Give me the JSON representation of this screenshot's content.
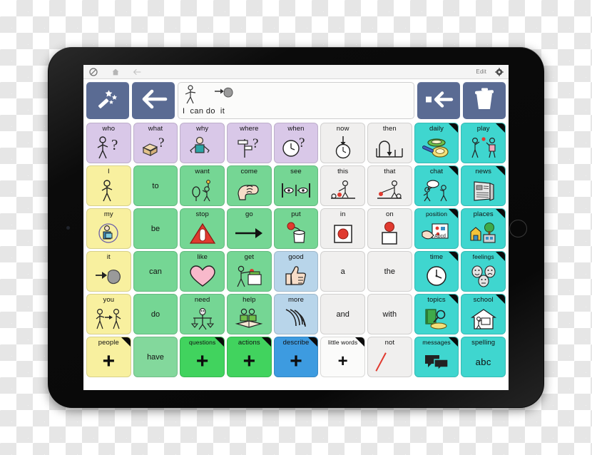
{
  "app": {
    "device": "tablet",
    "chrome": {
      "left_icons": [
        "no-entry-icon",
        "home-icon",
        "back-arrow-icon"
      ],
      "edit_label": "Edit",
      "right_icons": [
        "gear-icon"
      ]
    },
    "toolbar": {
      "predict_button": "magic-wand-icon",
      "back_button": "left-arrow-icon",
      "backspace_button": "backspace-icon",
      "clear_button": "trash-icon",
      "accent_color": "#5a6b93"
    },
    "message_bar": {
      "words": [
        "I",
        "can do",
        "it"
      ],
      "sentence": "I can do it",
      "symbols": [
        "stick-figure-icon",
        "arrow-to-blob-icon"
      ]
    }
  },
  "colors": {
    "lavender": "#d9c8e8",
    "white": "#f0efee",
    "teal": "#3fd6cf",
    "yellow": "#f8f09f",
    "green": "#75d694",
    "light_green": "#83d89c",
    "light_blue": "#b8d5ea",
    "bright_green": "#41d35e",
    "bright_blue": "#3d9be0",
    "toolbar_blue": "#5a6b93",
    "red_slash": "#e03a2f"
  },
  "grid": {
    "columns": 9,
    "rows": 6,
    "cells": [
      [
        {
          "label": "who",
          "color": "lavender",
          "icon": "person-question-icon",
          "fold": false
        },
        {
          "label": "what",
          "color": "lavender",
          "icon": "box-question-icon",
          "fold": false
        },
        {
          "label": "why",
          "color": "lavender",
          "icon": "shrug-person-icon",
          "fold": false
        },
        {
          "label": "where",
          "color": "lavender",
          "icon": "signpost-question-icon",
          "fold": false
        },
        {
          "label": "when",
          "color": "lavender",
          "icon": "clock-question-icon",
          "fold": false
        },
        {
          "label": "now",
          "color": "white",
          "icon": "clock-arrow-icon",
          "fold": false
        },
        {
          "label": "then",
          "color": "white",
          "icon": "sequence-arrow-icon",
          "fold": false
        },
        {
          "label": "daily",
          "color": "teal",
          "icon": "toothbrush-soap-icon",
          "fold": true
        },
        {
          "label": "play",
          "color": "teal",
          "icon": "two-people-ball-icon",
          "fold": true
        }
      ],
      [
        {
          "label": "I",
          "color": "yellow",
          "icon": "stick-figure-icon",
          "fold": false
        },
        {
          "label": "to",
          "color": "green",
          "icon": "",
          "fold": false,
          "center_text": true
        },
        {
          "label": "want",
          "color": "green",
          "icon": "person-reaching-icon",
          "fold": false
        },
        {
          "label": "come",
          "color": "green",
          "icon": "beckoning-hand-icon",
          "fold": false
        },
        {
          "label": "see",
          "color": "green",
          "icon": "eyes-between-bars-icon",
          "fold": false
        },
        {
          "label": "this",
          "color": "white",
          "icon": "person-pointing-near-icon",
          "fold": false
        },
        {
          "label": "that",
          "color": "white",
          "icon": "person-pointing-far-icon",
          "fold": false
        },
        {
          "label": "chat",
          "color": "teal",
          "icon": "two-people-talking-icon",
          "fold": true
        },
        {
          "label": "news",
          "color": "teal",
          "icon": "newspaper-icon",
          "fold": true
        }
      ],
      [
        {
          "label": "my",
          "color": "yellow",
          "icon": "person-holding-circle-icon",
          "fold": false
        },
        {
          "label": "be",
          "color": "green",
          "icon": "",
          "fold": false,
          "center_text": true
        },
        {
          "label": "stop",
          "color": "green",
          "icon": "warning-triangle-hand-icon",
          "fold": false
        },
        {
          "label": "go",
          "color": "green",
          "icon": "right-arrow-icon",
          "fold": false
        },
        {
          "label": "put",
          "color": "green",
          "icon": "ball-into-container-icon",
          "fold": false
        },
        {
          "label": "in",
          "color": "white",
          "icon": "ball-inside-box-icon",
          "fold": false
        },
        {
          "label": "on",
          "color": "white",
          "icon": "ball-on-box-icon",
          "fold": false
        },
        {
          "label": "position",
          "color": "teal",
          "icon": "hand-cards-abcd-icon",
          "fold": true
        },
        {
          "label": "places",
          "color": "teal",
          "icon": "houses-tree-icon",
          "fold": true
        }
      ],
      [
        {
          "label": "it",
          "color": "yellow",
          "icon": "arrow-to-blob-icon",
          "fold": false
        },
        {
          "label": "can",
          "color": "green",
          "icon": "",
          "fold": false,
          "center_text": true
        },
        {
          "label": "like",
          "color": "green",
          "icon": "pink-heart-icon",
          "fold": false
        },
        {
          "label": "get",
          "color": "green",
          "icon": "person-taking-icon",
          "fold": false
        },
        {
          "label": "good",
          "color": "light_blue",
          "icon": "thumbs-up-icon",
          "fold": false
        },
        {
          "label": "a",
          "color": "white",
          "icon": "",
          "fold": false,
          "center_text": true
        },
        {
          "label": "the",
          "color": "white",
          "icon": "",
          "fold": false,
          "center_text": true
        },
        {
          "label": "time",
          "color": "teal",
          "icon": "clock-icon",
          "fold": true
        },
        {
          "label": "feelings",
          "color": "teal",
          "icon": "faces-emotions-icon",
          "fold": true
        }
      ],
      [
        {
          "label": "you",
          "color": "yellow",
          "icon": "two-people-arrow-icon",
          "fold": false
        },
        {
          "label": "do",
          "color": "green",
          "icon": "",
          "fold": false,
          "center_text": true
        },
        {
          "label": "need",
          "color": "green",
          "icon": "person-scales-icon",
          "fold": false
        },
        {
          "label": "help",
          "color": "green",
          "icon": "two-people-book-icon",
          "fold": false
        },
        {
          "label": "more",
          "color": "light_blue",
          "icon": "waves-hand-icon",
          "fold": false
        },
        {
          "label": "and",
          "color": "white",
          "icon": "",
          "fold": false,
          "center_text": true
        },
        {
          "label": "with",
          "color": "white",
          "icon": "",
          "fold": false,
          "center_text": true
        },
        {
          "label": "topics",
          "color": "teal",
          "icon": "book-magnifier-icon",
          "fold": true
        },
        {
          "label": "school",
          "color": "teal",
          "icon": "school-house-icon",
          "fold": true
        }
      ],
      [
        {
          "label": "people",
          "color": "yellow",
          "icon": "plus-icon",
          "fold": true
        },
        {
          "label": "have",
          "color": "light_green",
          "icon": "",
          "fold": false,
          "center_text": true
        },
        {
          "label": "questions",
          "color": "bright_green",
          "icon": "plus-icon",
          "fold": true
        },
        {
          "label": "actions",
          "color": "bright_green",
          "icon": "plus-icon",
          "fold": true
        },
        {
          "label": "describe",
          "color": "bright_blue",
          "icon": "plus-icon",
          "fold": true
        },
        {
          "label": "little words",
          "color": "white_plus",
          "icon": "plus-icon",
          "fold": true
        },
        {
          "label": "not",
          "color": "white",
          "icon": "red-slash-icon",
          "fold": false
        },
        {
          "label": "messages",
          "color": "teal",
          "icon": "speech-bubbles-icon",
          "fold": true
        },
        {
          "label": "spelling",
          "color": "teal",
          "icon": "abc-text-icon",
          "fold": false,
          "text_art": "abc"
        }
      ]
    ]
  }
}
